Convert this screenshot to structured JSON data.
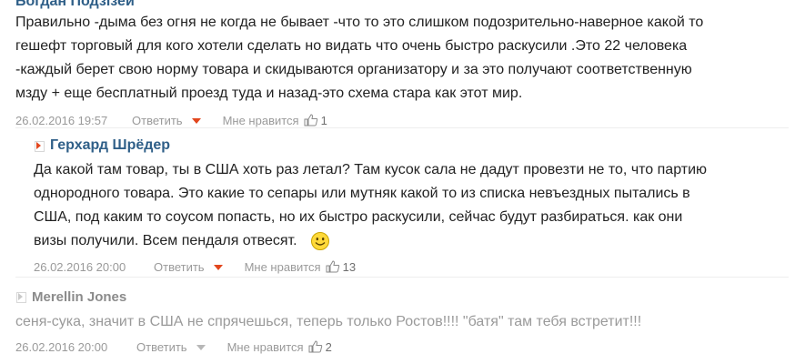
{
  "comments": [
    {
      "author": "Богдан Подзізей",
      "text_lines": [
        "Правильно -дыма без огня не когда не бывает -что то это слишком подозрительно-наверное какой то",
        "гешефт торговый для кого хотели сделать но видать что очень быстро раскусили .Это 22 человека",
        "-каждый берет свою норму товара и скидываются организатору и за это получают соответственную",
        "мзду + еще бесплатный проезд туда и назад-это схема стара как этот мир."
      ],
      "date": "26.02.2016 19:57",
      "reply_label": "Ответить",
      "likes_label": "Мне нравится",
      "like_count": "1"
    },
    {
      "author": "Герхард Шрёдер",
      "text_lines": [
        "Да какой там товар, ты в США хоть раз летал? Там кусок сала не дадут провезти не то, что партию",
        "однородного товара. Это какие то сепары или мутняк какой то из списка невъездных пытались в",
        "США, под каким то соусом попасть, но их быстро раскусили, сейчас будут разбираться. как они",
        "визы получили. Всем пендаля отвесят."
      ],
      "date": "26.02.2016 20:00",
      "reply_label": "Ответить",
      "likes_label": "Мне нравится",
      "like_count": "13"
    },
    {
      "author": "Merellin Jones",
      "text_lines": [
        "сеня-сука, значит в США не спрячешься, теперь только Ростов!!!! \"батя\" там тебя встретит!!!"
      ],
      "date": "26.02.2016 20:00",
      "reply_label": "Ответить",
      "likes_label": "Мне нравится",
      "like_count": "2"
    }
  ],
  "icons": {
    "author_marker": "arrow-right-icon",
    "reply_menu": "caret-down-icon",
    "like": "thumbs-up-icon",
    "emoticon": "smiley-icon"
  },
  "colors": {
    "author": "#2f5f88",
    "accent": "#e2461d",
    "meta": "#9a9a9a",
    "text": "#222222"
  }
}
